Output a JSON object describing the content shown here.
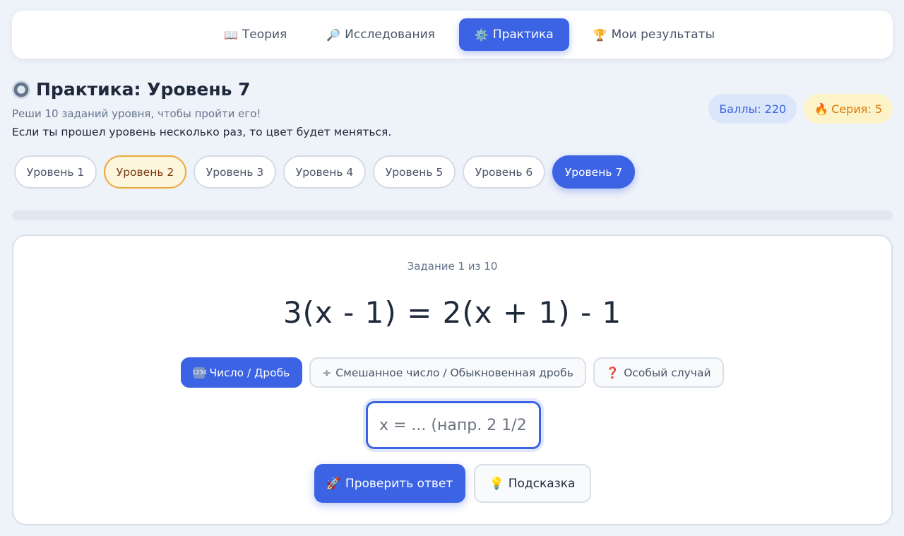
{
  "nav": {
    "tabs": [
      {
        "icon": "📖",
        "label": "Теория"
      },
      {
        "icon": "🔎",
        "label": "Исследования"
      },
      {
        "icon": "⚙️",
        "label": "Практика"
      },
      {
        "icon": "🏆",
        "label": "Мои результаты"
      }
    ],
    "active_index": 2
  },
  "header": {
    "title": "Практика: Уровень 7",
    "subtitle": "Реши 10 заданий уровня, чтобы пройти его!",
    "note": "Если ты прошел уровень несколько раз, то цвет будет меняться."
  },
  "stats": {
    "score_label": "Баллы: 220",
    "streak_icon": "🔥",
    "streak_label": "Серия: 5"
  },
  "levels": [
    {
      "label": "Уровень 1",
      "state": "default"
    },
    {
      "label": "Уровень 2",
      "state": "completed"
    },
    {
      "label": "Уровень 3",
      "state": "default"
    },
    {
      "label": "Уровень 4",
      "state": "default"
    },
    {
      "label": "Уровень 5",
      "state": "default"
    },
    {
      "label": "Уровень 6",
      "state": "default"
    },
    {
      "label": "Уровень 7",
      "state": "active"
    }
  ],
  "progress": {
    "fraction": 0.0
  },
  "task": {
    "counter": "Задание 1 из 10",
    "equation": "3(x - 1) = 2(x + 1) - 1",
    "modes": [
      {
        "icon": "1234",
        "label": "Число / Дробь"
      },
      {
        "icon": "÷",
        "label": "Смешанное число / Обыкновенная дробь"
      },
      {
        "icon": "❓",
        "label": "Особый случай"
      }
    ],
    "active_mode": 0,
    "input_placeholder": "x = ... (напр. 2 1/2",
    "input_value": "",
    "check_icon": "🚀",
    "check_label": "Проверить ответ",
    "hint_icon": "💡",
    "hint_label": "Подсказка"
  },
  "colors": {
    "accent": "#3b63e4",
    "completed_border": "#eaa93c",
    "completed_bg": "#fdf6dc",
    "background": "#eef2f9"
  }
}
